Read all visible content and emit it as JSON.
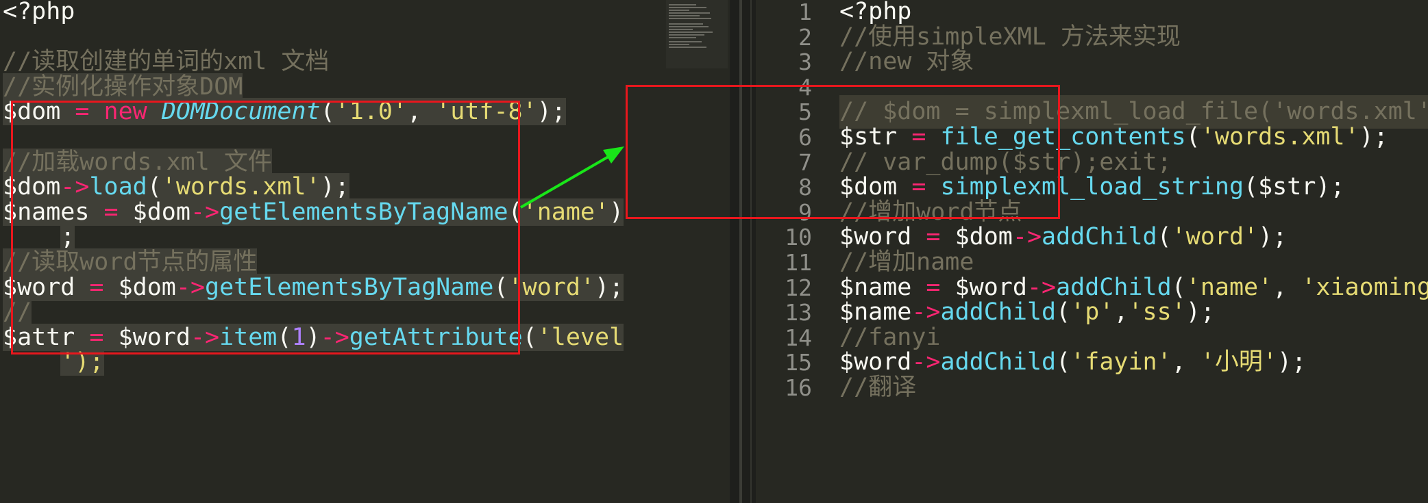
{
  "left_pane": {
    "lines": [
      [
        [
          "<?php",
          ""
        ]
      ],
      [
        [
          "",
          ""
        ]
      ],
      [
        [
          "//读取创建的单词的xml 文档",
          "cm"
        ]
      ],
      [
        [
          "//实例化操作对象DOM",
          "cm sel"
        ]
      ],
      [
        [
          "$dom",
          "sel"
        ],
        [
          " = ",
          "kw sel"
        ],
        [
          "new ",
          "kw sel"
        ],
        [
          "DOMDocument",
          "cls sel"
        ],
        [
          "(",
          "sel"
        ],
        [
          "'1.0'",
          "str sel"
        ],
        [
          ", ",
          "sel"
        ],
        [
          "'utf-8'",
          "str sel"
        ],
        [
          ");",
          "sel"
        ]
      ],
      [
        [
          "",
          ""
        ]
      ],
      [
        [
          "//加载words.xml 文件",
          "cm sel"
        ]
      ],
      [
        [
          "$dom",
          "sel"
        ],
        [
          "->",
          "kw sel"
        ],
        [
          "load",
          "fn sel"
        ],
        [
          "(",
          "sel"
        ],
        [
          "'words.xml'",
          "str sel"
        ],
        [
          ");",
          "sel"
        ]
      ],
      [
        [
          "$names",
          "sel"
        ],
        [
          " = ",
          "kw sel"
        ],
        [
          "$dom",
          "sel"
        ],
        [
          "->",
          "kw sel"
        ],
        [
          "getElementsByTagName",
          "fn sel"
        ],
        [
          "(",
          "sel"
        ],
        [
          "'name'",
          "str sel"
        ],
        [
          ")",
          "sel"
        ]
      ],
      [
        [
          "    ",
          ""
        ],
        [
          ";",
          "sel"
        ]
      ],
      [
        [
          "//读取word节点的属性",
          "cm sel"
        ]
      ],
      [
        [
          "$word",
          "sel"
        ],
        [
          " = ",
          "kw sel"
        ],
        [
          "$dom",
          "sel"
        ],
        [
          "->",
          "kw sel"
        ],
        [
          "getElementsByTagName",
          "fn sel"
        ],
        [
          "(",
          "sel"
        ],
        [
          "'word'",
          "str sel"
        ],
        [
          ");",
          "sel"
        ]
      ],
      [
        [
          "//",
          "cm sel"
        ]
      ],
      [
        [
          "$attr",
          "sel"
        ],
        [
          " = ",
          "kw sel"
        ],
        [
          "$word",
          "sel"
        ],
        [
          "->",
          "kw sel"
        ],
        [
          "item",
          "fn sel"
        ],
        [
          "(",
          "sel"
        ],
        [
          "1",
          "num sel"
        ],
        [
          ")",
          "sel"
        ],
        [
          "->",
          "kw sel"
        ],
        [
          "getAttribute",
          "fn sel"
        ],
        [
          "(",
          "sel"
        ],
        [
          "'level",
          "str sel"
        ]
      ],
      [
        [
          "    ",
          ""
        ],
        [
          "');",
          "str sel"
        ]
      ]
    ]
  },
  "right_pane": {
    "line_numbers": [
      "1",
      "2",
      "3",
      "4",
      "5",
      "6",
      "7",
      "8",
      "9",
      "10",
      "11",
      "12",
      "13",
      "14",
      "15",
      "16"
    ],
    "current_line_index": 4,
    "lines": [
      [
        [
          "<?php",
          ""
        ]
      ],
      [
        [
          "//使用simpleXML 方法来实现",
          "cm"
        ]
      ],
      [
        [
          "//new 对象",
          "cm"
        ]
      ],
      [
        [
          "",
          ""
        ]
      ],
      [
        [
          "// $dom = simplexml_load_file('words.xml');",
          "cm"
        ]
      ],
      [
        [
          "$str",
          ""
        ],
        [
          " = ",
          "kw"
        ],
        [
          "file_get_contents",
          "fn"
        ],
        [
          "(",
          ""
        ],
        [
          "'words.xml'",
          "str"
        ],
        [
          ");",
          ""
        ]
      ],
      [
        [
          "// var_dump($str);exit;",
          "cm"
        ]
      ],
      [
        [
          "$dom",
          ""
        ],
        [
          " = ",
          "kw"
        ],
        [
          "simplexml_load_string",
          "fn"
        ],
        [
          "($str);",
          ""
        ]
      ],
      [
        [
          "//增加word节点",
          "cm"
        ]
      ],
      [
        [
          "$word",
          ""
        ],
        [
          " = ",
          "kw"
        ],
        [
          "$dom",
          ""
        ],
        [
          "->",
          "kw"
        ],
        [
          "addChild",
          "fn"
        ],
        [
          "(",
          ""
        ],
        [
          "'word'",
          "str"
        ],
        [
          ");",
          ""
        ]
      ],
      [
        [
          "//增加name",
          "cm"
        ]
      ],
      [
        [
          "$name",
          ""
        ],
        [
          " = ",
          "kw"
        ],
        [
          "$word",
          ""
        ],
        [
          "->",
          "kw"
        ],
        [
          "addChild",
          "fn"
        ],
        [
          "(",
          ""
        ],
        [
          "'name'",
          "str"
        ],
        [
          ", ",
          ""
        ],
        [
          "'xiaoming'",
          "str"
        ],
        [
          ");",
          ""
        ]
      ],
      [
        [
          "$name",
          ""
        ],
        [
          "->",
          "kw"
        ],
        [
          "addChild",
          "fn"
        ],
        [
          "(",
          ""
        ],
        [
          "'p'",
          "str"
        ],
        [
          ",",
          ""
        ],
        [
          "'ss'",
          "str"
        ],
        [
          ");",
          ""
        ]
      ],
      [
        [
          "//fanyi",
          "cm"
        ]
      ],
      [
        [
          "$word",
          ""
        ],
        [
          "->",
          "kw"
        ],
        [
          "addChild",
          "fn"
        ],
        [
          "(",
          ""
        ],
        [
          "'fayin'",
          "str"
        ],
        [
          ", ",
          ""
        ],
        [
          "'小明'",
          "str"
        ],
        [
          ");",
          ""
        ]
      ],
      [
        [
          "//翻译",
          "cm"
        ]
      ]
    ]
  },
  "annotation": {
    "box_color": "#e8171d",
    "arrow_color": "#19e619"
  }
}
